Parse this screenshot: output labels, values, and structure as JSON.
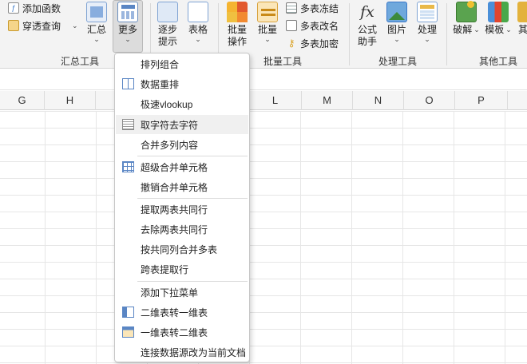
{
  "ribbon": {
    "add_function": "添加函数",
    "pivot_query": "穿透查询",
    "summary": "汇总",
    "more": "更多",
    "summary_tools": "汇总工具",
    "step_prompt_l1": "逐步",
    "step_prompt_l2": "提示",
    "sheet_format": "表格",
    "batch_op_l1": "批量",
    "batch_op_l2": "操作",
    "batch": "批量",
    "multi_freeze": "多表冻结",
    "multi_rename": "多表改名",
    "multi_encrypt": "多表加密",
    "batch_tools": "批量工具",
    "formula_l1": "公式",
    "formula_l2": "助手",
    "fx_glyph": "fx",
    "image": "图片",
    "process": "处理",
    "process_tools": "处理工具",
    "crack": "破解",
    "template": "模板",
    "other_partial": "其他",
    "other_tools": "其他工具"
  },
  "columns": [
    "G",
    "H",
    "L",
    "M",
    "N",
    "O",
    "P"
  ],
  "menu": {
    "items": [
      {
        "label": "排列组合",
        "icon": "none"
      },
      {
        "label": "数据重排",
        "icon": "reorder-icon"
      },
      {
        "label": "极速vlookup",
        "icon": "none"
      },
      {
        "label": "取字符去字符",
        "icon": "text-extract-icon"
      },
      {
        "label": "合并多列内容",
        "icon": "none"
      },
      {
        "label": "超级合并单元格",
        "icon": "merge-cells-icon"
      },
      {
        "label": "撤销合并单元格",
        "icon": "none"
      },
      {
        "label": "提取两表共同行",
        "icon": "none"
      },
      {
        "label": "去除两表共同行",
        "icon": "none"
      },
      {
        "label": "按共同列合并多表",
        "icon": "none"
      },
      {
        "label": "跨表提取行",
        "icon": "none"
      },
      {
        "label": "添加下拉菜单",
        "icon": "none"
      },
      {
        "label": "二维表转一维表",
        "icon": "2d-to-1d-icon"
      },
      {
        "label": "一维表转二维表",
        "icon": "1d-to-2d-icon"
      },
      {
        "label": "连接数据源改为当前文档",
        "icon": "none"
      }
    ]
  },
  "colors": {
    "ribbon_bg": "#f3f3f3",
    "menu_hover": "#f0f0f0",
    "accent_blue": "#3a78c9",
    "accent_orange": "#f0a020"
  }
}
